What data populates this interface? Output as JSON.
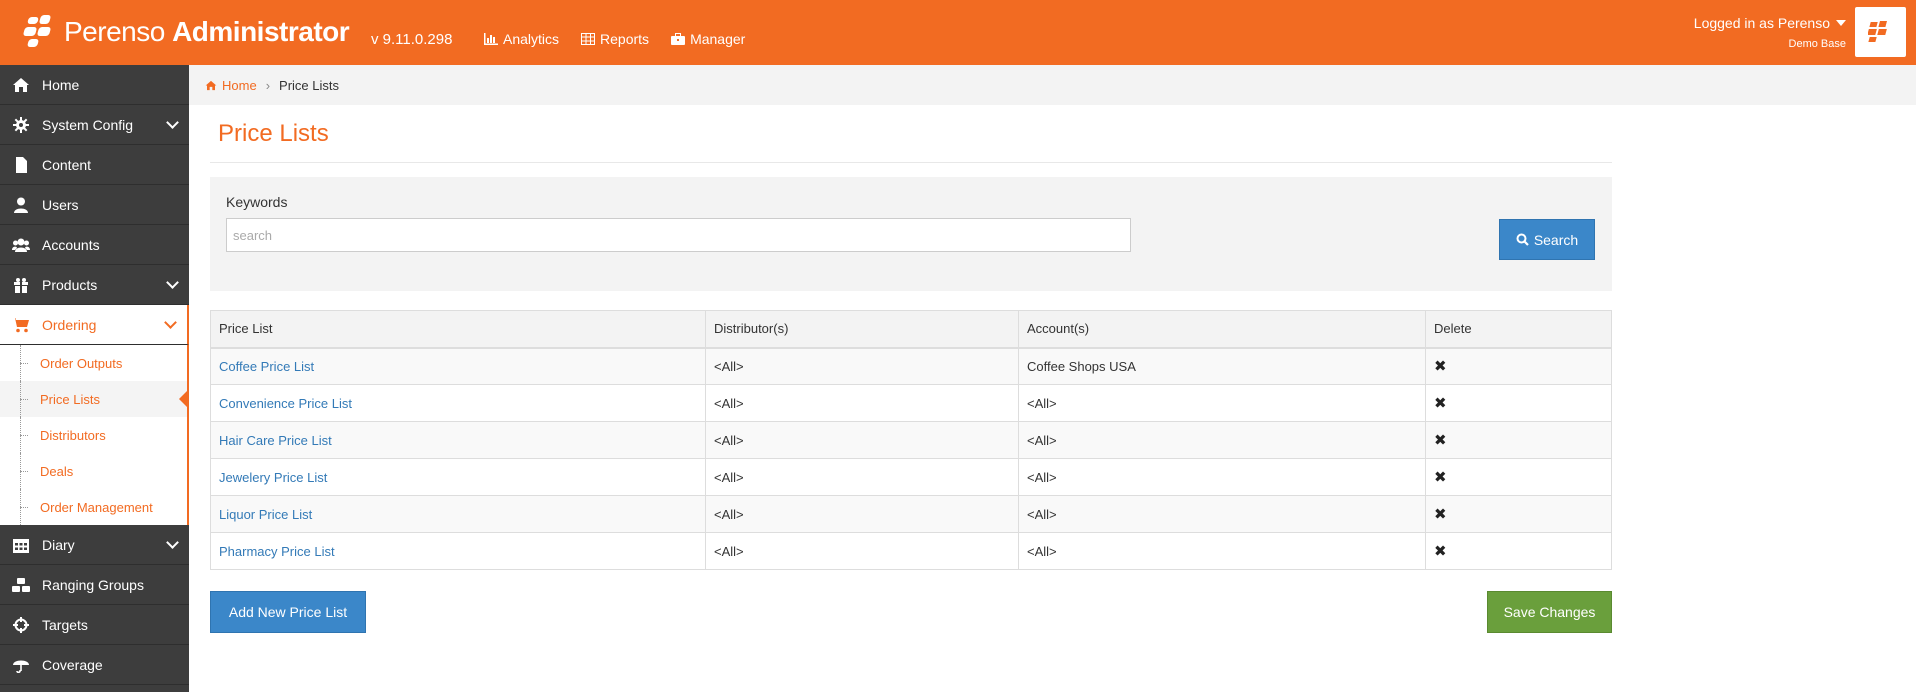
{
  "colors": {
    "brand": "#f26b22",
    "sidebar": "#3d3d3d",
    "primary_button": "#3b87c9",
    "save_button": "#6a9f3c",
    "link": "#337ab7"
  },
  "header": {
    "brand_light": "Perenso",
    "brand_bold": "Administrator",
    "version": "v 9.11.0.298",
    "nav": [
      {
        "label": "Analytics",
        "icon": "bar-chart-icon"
      },
      {
        "label": "Reports",
        "icon": "table-icon"
      },
      {
        "label": "Manager",
        "icon": "briefcase-icon"
      }
    ],
    "user": {
      "logged_in": "Logged in as Perenso",
      "base": "Demo Base"
    }
  },
  "sidebar": {
    "items": [
      {
        "label": "Home",
        "icon": "home-icon"
      },
      {
        "label": "System Config",
        "icon": "cog-icon"
      },
      {
        "label": "Content",
        "icon": "file-icon"
      },
      {
        "label": "Users",
        "icon": "user-icon"
      },
      {
        "label": "Accounts",
        "icon": "users-icon"
      },
      {
        "label": "Products",
        "icon": "gift-icon"
      },
      {
        "label": "Ordering",
        "icon": "cart-icon"
      },
      {
        "label": "Diary",
        "icon": "calendar-icon"
      },
      {
        "label": "Ranging Groups",
        "icon": "cubes-icon"
      },
      {
        "label": "Targets",
        "icon": "crosshairs-icon"
      },
      {
        "label": "Coverage",
        "icon": "umbrella-icon"
      }
    ],
    "ordering_sub": [
      {
        "label": "Order Outputs"
      },
      {
        "label": "Price Lists"
      },
      {
        "label": "Distributors"
      },
      {
        "label": "Deals"
      },
      {
        "label": "Order Management"
      }
    ]
  },
  "breadcrumb": {
    "home": "Home",
    "current": "Price Lists"
  },
  "main": {
    "title": "Price Lists",
    "search": {
      "label": "Keywords",
      "placeholder": "search",
      "value": "",
      "button": "Search"
    },
    "table": {
      "headers": [
        "Price List",
        "Distributor(s)",
        "Account(s)",
        "Delete"
      ],
      "rows": [
        {
          "name": "Coffee Price List",
          "distributors": "<All>",
          "accounts": "Coffee Shops USA",
          "delete": "✖"
        },
        {
          "name": "Convenience Price List",
          "distributors": "<All>",
          "accounts": "<All>",
          "delete": "✖"
        },
        {
          "name": "Hair Care Price List",
          "distributors": "<All>",
          "accounts": "<All>",
          "delete": "✖"
        },
        {
          "name": "Jewelery Price List",
          "distributors": "<All>",
          "accounts": "<All>",
          "delete": "✖"
        },
        {
          "name": "Liquor Price List",
          "distributors": "<All>",
          "accounts": "<All>",
          "delete": "✖"
        },
        {
          "name": "Pharmacy Price List",
          "distributors": "<All>",
          "accounts": "<All>",
          "delete": "✖"
        }
      ]
    },
    "add_button": "Add New Price List",
    "save_button": "Save Changes"
  }
}
